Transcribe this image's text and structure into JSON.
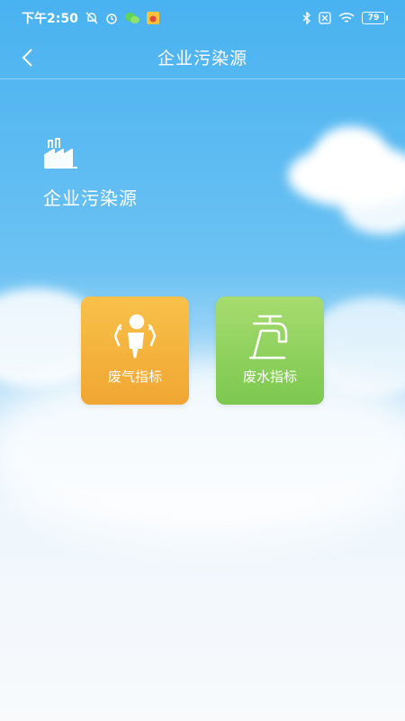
{
  "status_bar": {
    "time": "下午2:50",
    "battery": "79",
    "left_icons": [
      "alarm-off-icon",
      "alarm-clock-icon",
      "wechat-icon",
      "weibo-icon"
    ],
    "right_icons": [
      "bluetooth-icon",
      "sim-none-icon",
      "wifi-icon",
      "battery-icon"
    ]
  },
  "header": {
    "title": "企业污染源",
    "back_icon": "chevron-left-icon"
  },
  "section": {
    "icon": "factory-icon",
    "title": "企业污染源"
  },
  "tiles": [
    {
      "label": "废气指标",
      "icon": "exhaust-gas-icon",
      "color_top": "#f8c149",
      "color_bottom": "#f0a632"
    },
    {
      "label": "废水指标",
      "icon": "faucet-water-icon",
      "color_top": "#a6dc6f",
      "color_bottom": "#7cc84f"
    }
  ],
  "colors": {
    "sky_top": "#49b2f0",
    "sky_bottom": "#f8fafc",
    "text": "#ffffff"
  }
}
